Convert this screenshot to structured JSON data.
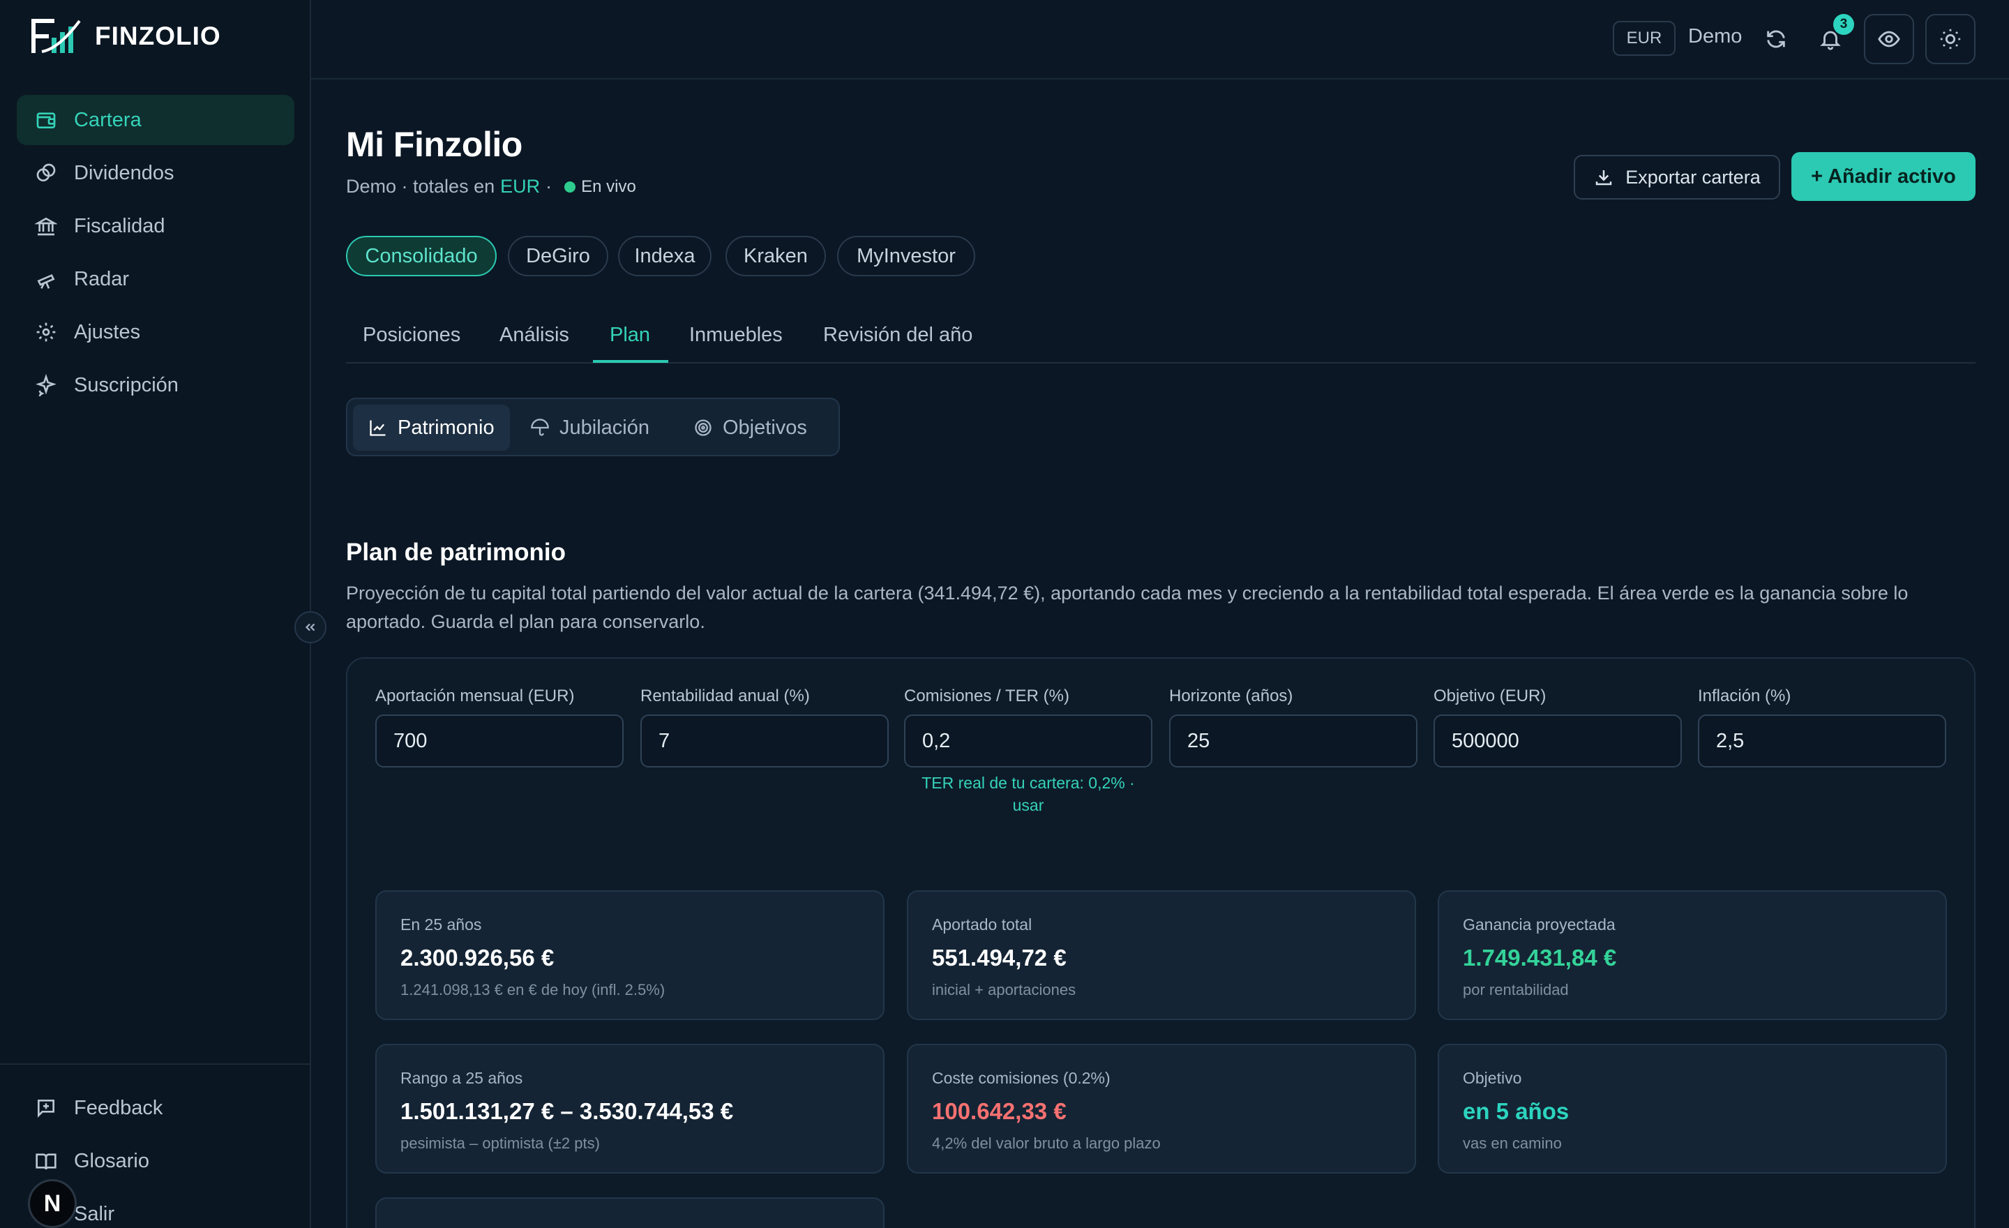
{
  "app": {
    "brand": "FINZOLIO"
  },
  "sidebar": {
    "items": [
      {
        "label": "Cartera",
        "icon": "wallet-icon",
        "active": true
      },
      {
        "label": "Dividendos",
        "icon": "coins-icon"
      },
      {
        "label": "Fiscalidad",
        "icon": "bank-icon"
      },
      {
        "label": "Radar",
        "icon": "telescope-icon"
      },
      {
        "label": "Ajustes",
        "icon": "gear-icon"
      },
      {
        "label": "Suscripción",
        "icon": "sparkles-icon"
      }
    ],
    "bottom_items": [
      {
        "label": "Feedback",
        "icon": "message-plus-icon"
      },
      {
        "label": "Glosario",
        "icon": "book-icon"
      },
      {
        "label": "Salir",
        "icon": "logout-icon"
      }
    ],
    "avatar_letter": "N"
  },
  "topbar": {
    "currency": "EUR",
    "mode": "Demo",
    "notifications_count": "3"
  },
  "header": {
    "title": "Mi Finzolio",
    "subtitle_prefix": "Demo · totales en",
    "subtitle_currency": "EUR",
    "separator": "·",
    "live_label": "En vivo",
    "export_label": "Exportar cartera",
    "add_label": "+ Añadir activo"
  },
  "brokers": [
    "Consolidado",
    "DeGiro",
    "Indexa",
    "Kraken",
    "MyInvestor"
  ],
  "tabs": [
    "Posiciones",
    "Análisis",
    "Plan",
    "Inmuebles",
    "Revisión del año"
  ],
  "segments": [
    "Patrimonio",
    "Jubilación",
    "Objetivos"
  ],
  "plan": {
    "title": "Plan de patrimonio",
    "description": "Proyección de tu capital total partiendo del valor actual de la cartera (341.494,72 €), aportando cada mes y creciendo a la rentabilidad total esperada. El área verde es la ganancia sobre lo aportado. Guarda el plan para conservarlo.",
    "fields": [
      {
        "label": "Aportación mensual (EUR)",
        "value": "700"
      },
      {
        "label": "Rentabilidad anual (%)",
        "value": "7"
      },
      {
        "label": "Comisiones / TER (%)",
        "value": "0,2"
      },
      {
        "label": "Horizonte (años)",
        "value": "25"
      },
      {
        "label": "Objetivo (EUR)",
        "value": "500000"
      },
      {
        "label": "Inflación (%)",
        "value": "2,5"
      }
    ],
    "ter_hint": "TER real de tu cartera: 0,2% · usar",
    "stats": [
      {
        "label": "En 25 años",
        "value": "2.300.926,56 €",
        "sub": "1.241.098,13 € en € de hoy (infl. 2.5%)"
      },
      {
        "label": "Aportado total",
        "value": "551.494,72 €",
        "sub": "inicial + aportaciones"
      },
      {
        "label": "Ganancia proyectada",
        "value": "1.749.431,84 €",
        "sub": "por rentabilidad"
      },
      {
        "label": "Rango a 25 años",
        "value": "1.501.131,27 € – 3.530.744,53 €",
        "sub": "pesimista – optimista (±2 pts)"
      },
      {
        "label": "Coste comisiones (0.2%)",
        "value": "100.642,33 €",
        "sub": "4,2% del valor bruto a largo plazo"
      },
      {
        "label": "Objetivo",
        "value": "en 5 años",
        "sub": "vas en camino"
      }
    ]
  },
  "colors": {
    "accent": "#2cc9b3",
    "background": "#0b1724",
    "positive": "#34d399",
    "negative": "#f87171"
  }
}
